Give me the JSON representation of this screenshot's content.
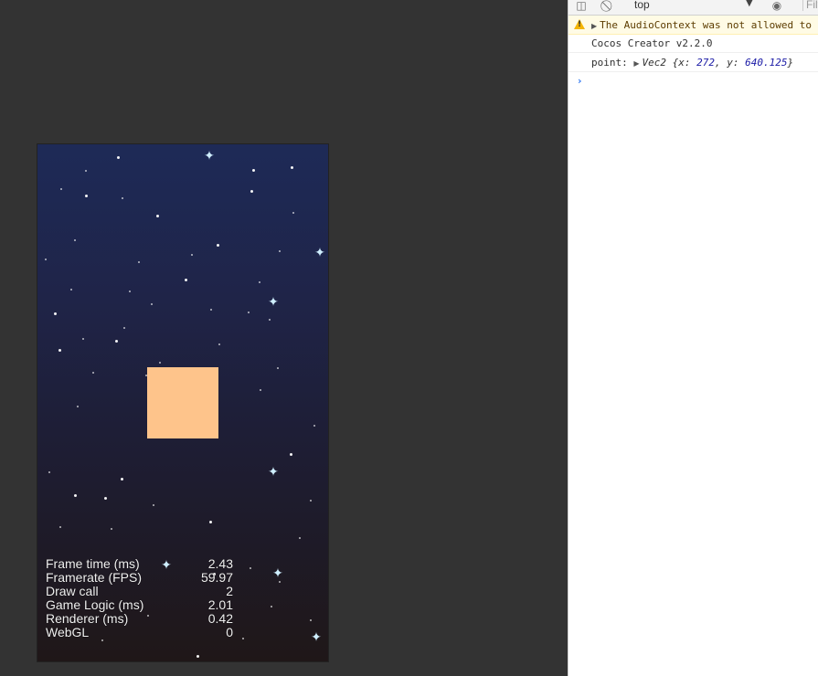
{
  "game": {
    "stats": [
      {
        "label": "Frame time (ms)",
        "value": "2.43"
      },
      {
        "label": "Framerate (FPS)",
        "value": "59.97"
      },
      {
        "label": "Draw call",
        "value": "2"
      },
      {
        "label": "Game Logic (ms)",
        "value": "2.01"
      },
      {
        "label": "Renderer (ms)",
        "value": "0.42"
      },
      {
        "label": "WebGL",
        "value": "0"
      }
    ],
    "square_color": "#fec48b",
    "background_top_color": "#1e2a57",
    "background_bottom_color": "#1f1718"
  },
  "devtools": {
    "toolbar": {
      "panel_icon": "sidebar-toggle-icon",
      "clear_icon": "clear-console-icon",
      "context": "top",
      "dropdown_icon": "dropdown-arrow-icon",
      "eye_icon": "live-expression-eye-icon",
      "filter_label": "Filt"
    },
    "logs": {
      "warning_text": "The AudioContext was not allowed to start",
      "version_text": "Cocos Creator v2.2.0",
      "point_label": "point:",
      "point_class": "Vec2",
      "point_x_key": "x:",
      "point_x": "272",
      "point_y_key": "y:",
      "point_y": "640.125"
    },
    "prompt_symbol": "›"
  }
}
